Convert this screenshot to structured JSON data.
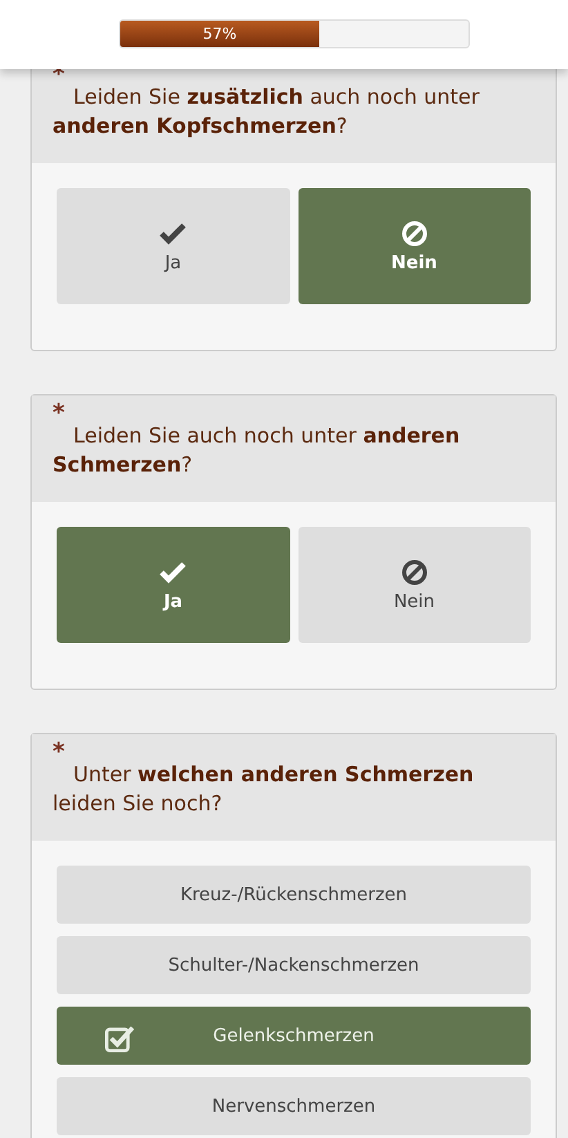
{
  "progress": {
    "label": "57%",
    "level": 0.57
  },
  "questions": [
    {
      "kind": "yesno",
      "required_mark": "*",
      "text": "Leiden Sie **zusätzlich** auch noch unter **anderen Kopfschmerzen**?",
      "options": [
        {
          "label": "Ja",
          "selected": false
        },
        {
          "label": "Nein",
          "selected": true
        }
      ]
    },
    {
      "kind": "yesno",
      "required_mark": "*",
      "text": "Leiden Sie auch noch unter **anderen Schmerzen**?",
      "options": [
        {
          "label": "Ja",
          "selected": true
        },
        {
          "label": "Nein",
          "selected": false
        }
      ]
    },
    {
      "kind": "multi",
      "required_mark": "*",
      "text": "Unter **welchen anderen Schmerzen** leiden Sie noch?",
      "options": [
        {
          "label": "Kreuz-/Rückenschmerzen",
          "selected": false
        },
        {
          "label": "Schulter-/Nackenschmerzen",
          "selected": false
        },
        {
          "label": "Gelenkschmerzen",
          "selected": true
        },
        {
          "label": "Nervenschmerzen",
          "selected": false
        }
      ]
    }
  ]
}
